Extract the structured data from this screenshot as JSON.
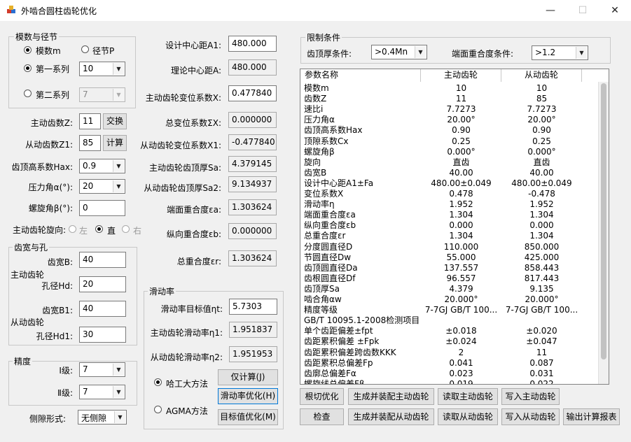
{
  "window": {
    "title": "外啮合圆柱齿轮优化",
    "minimize": "—",
    "maximize": "☐",
    "close": "✕"
  },
  "module_group": {
    "title": "模数与径节",
    "radio_module": "模数m",
    "radio_pitch": "径节P",
    "radio_series1": "第一系列",
    "series1_value": "10",
    "radio_series2": "第二系列",
    "series2_value": "7"
  },
  "teeth": {
    "driving_label": "主动齿数Z:",
    "driving_value": "11",
    "swap_button": "交换",
    "driven_label": "从动齿数Z1:",
    "driven_value": "85",
    "calc_button": "计算",
    "addendum_label": "齿顶高系数Hax:",
    "addendum_value": "0.9",
    "pressure_label": "压力角α(°):",
    "pressure_value": "20",
    "helix_label": "螺旋角β(°):",
    "helix_value": "0",
    "rotation_label": "主动齿轮旋向:",
    "rot_left": "左",
    "rot_straight": "直",
    "rot_right": "右"
  },
  "width_group": {
    "title": "齿宽与孔",
    "driving_gear": "主动齿轮",
    "width_b_label": "齿宽B:",
    "width_b_value": "40",
    "hole_hd_label": "孔径Hd:",
    "hole_hd_value": "20",
    "driven_gear": "从动齿轮",
    "width_b1_label": "齿宽B1:",
    "width_b1_value": "40",
    "hole_hd1_label": "孔径Hd1:",
    "hole_hd1_value": "30"
  },
  "precision_group": {
    "title": "精度",
    "level1_label": "Ⅰ级:",
    "level1_value": "7",
    "level2_label": "Ⅱ级:",
    "level2_value": "7"
  },
  "flank": {
    "label": "侧隙形式:",
    "value": "无侧隙"
  },
  "center_fields": {
    "design_center_label": "设计中心距A1:",
    "design_center_value": "480.000",
    "theory_center_label": "理论中心距A:",
    "theory_center_value": "480.000",
    "drive_shift_label": "主动齿轮变位系数X:",
    "drive_shift_value": "0.477840",
    "total_shift_label": "总变位系数ΣX:",
    "total_shift_value": "0.000000",
    "driven_shift_label": "从动齿轮变位系数X1:",
    "driven_shift_value": "-0.477840",
    "drive_thick_label": "主动齿轮齿顶厚Sa:",
    "drive_thick_value": "4.379145",
    "driven_thick_label": "从动齿轮齿顶厚Sa2:",
    "driven_thick_value": "9.134937",
    "face_contact_label": "端面重合度εa:",
    "face_contact_value": "1.303624",
    "axial_contact_label": "纵向重合度εb:",
    "axial_contact_value": "0.000000",
    "total_contact_label": "总重合度εr:",
    "total_contact_value": "1.303624"
  },
  "slide_group": {
    "title": "滑动率",
    "target_label": "滑动率目标值ηt:",
    "target_value": "5.7303",
    "drive_label": "主动齿轮滑动率η1:",
    "drive_value": "1.951837",
    "driven_label": "从动齿轮滑动率η2:",
    "driven_value": "1.951953",
    "method_hit": "哈工大方法",
    "method_agma": "AGMA方法",
    "calc_only_button": "仅计算(J)",
    "slide_opt_button": "滑动率优化(H)",
    "target_opt_button": "目标值优化(M)"
  },
  "limit_group": {
    "title": "限制条件",
    "tip_thick_label": "齿顶厚条件:",
    "tip_thick_value": ">0.4Mn",
    "contact_label": "端面重合度条件:",
    "contact_value": ">1.2"
  },
  "table": {
    "headers": [
      "参数名称",
      "主动齿轮",
      "从动齿轮"
    ],
    "rows": [
      [
        "模数m",
        "10",
        "10"
      ],
      [
        "齿数Z",
        "11",
        "85"
      ],
      [
        "速比i",
        "7.7273",
        "7.7273"
      ],
      [
        "压力角α",
        "20.00°",
        "20.00°"
      ],
      [
        "齿顶高系数Hax",
        "0.90",
        "0.90"
      ],
      [
        "顶隙系数Cx",
        "0.25",
        "0.25"
      ],
      [
        "螺旋角β",
        "0.000°",
        "0.000°"
      ],
      [
        "旋向",
        "直齿",
        "直齿"
      ],
      [
        "齿宽B",
        "40.00",
        "40.00"
      ],
      [
        "设计中心距A1±Fa",
        "480.00±0.049",
        "480.00±0.049"
      ],
      [
        "变位系数X",
        "0.478",
        "-0.478"
      ],
      [
        "滑动率η",
        "1.952",
        "1.952"
      ],
      [
        "端面重合度εa",
        "1.304",
        "1.304"
      ],
      [
        "纵向重合度εb",
        "0.000",
        "0.000"
      ],
      [
        "总重合度εr",
        "1.304",
        "1.304"
      ],
      [
        "分度圆直径D",
        "110.000",
        "850.000"
      ],
      [
        "节圆直径Dw",
        "55.000",
        "425.000"
      ],
      [
        "齿顶圆直径Da",
        "137.557",
        "858.443"
      ],
      [
        "齿根圆直径Df",
        "96.557",
        "817.443"
      ],
      [
        "齿顶厚Sa",
        "4.379",
        "9.135"
      ],
      [
        "啮合角αw",
        "20.000°",
        "20.000°"
      ],
      [
        "精度等级",
        "7-7GJ GB/T 100...",
        "7-7GJ GB/T 100..."
      ],
      [
        "GB/T 10095.1-2008检测项目",
        "",
        ""
      ],
      [
        "单个齿距偏差±fpt",
        "±0.018",
        "±0.020"
      ],
      [
        "齿距累积偏差 ±Fpk",
        "±0.024",
        "±0.047"
      ],
      [
        "齿距累积偏差跨齿数KKK",
        "2",
        "11"
      ],
      [
        "齿距累积总偏差Fp",
        "0.041",
        "0.087"
      ],
      [
        "齿廓总偏差Fα",
        "0.023",
        "0.031"
      ],
      [
        "螺旋线总偏差Fβ",
        "0.019",
        "0.022"
      ]
    ]
  },
  "bottom_buttons": {
    "undercut": "根切优化",
    "gen_drive": "生成并装配主动齿轮",
    "read_drive": "读取主动齿轮",
    "write_drive": "写入主动齿轮",
    "check": "检查",
    "gen_driven": "生成并装配从动齿轮",
    "read_driven": "读取从动齿轮",
    "write_driven": "写入从动齿轮",
    "report": "输出计算报表"
  }
}
